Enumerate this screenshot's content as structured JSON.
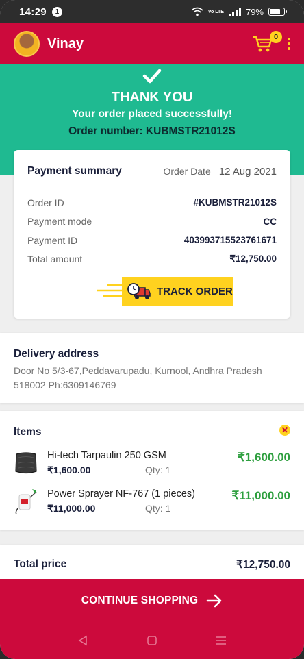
{
  "status_bar": {
    "time": "14:29",
    "notification_count": "1",
    "network": "Vo LTE",
    "battery": "79%",
    "battery_level": 0.79
  },
  "header": {
    "username": "Vinay",
    "cart_count": "0"
  },
  "confirmation": {
    "title": "THANK YOU",
    "message": "Your order placed successfully!",
    "order_number": "Order number: KUBMSTR21012S"
  },
  "payment_summary": {
    "title": "Payment summary",
    "order_date_label": "Order Date",
    "order_date": "12 Aug 2021",
    "rows": [
      {
        "label": "Order ID",
        "value": "#KUBMSTR21012S"
      },
      {
        "label": "Payment mode",
        "value": "CC"
      },
      {
        "label": "Payment ID",
        "value": "403993715523761671"
      },
      {
        "label": "Total amount",
        "value": "₹12,750.00"
      }
    ],
    "track_button": "TRACK ORDER"
  },
  "delivery": {
    "title": "Delivery address",
    "address": "Door No 5/3-67,Peddavarupadu, Kurnool, Andhra Pradesh 518002 Ph:6309146769"
  },
  "items": {
    "title": "Items",
    "list": [
      {
        "name": "Hi-tech Tarpaulin 250 GSM",
        "price": "₹1,600.00",
        "qty": "Qty: 1",
        "total": "₹1,600.00",
        "icon": "tarpaulin-icon"
      },
      {
        "name": "Power Sprayer NF-767 (1 pieces)",
        "price": "₹11,000.00",
        "qty": "Qty: 1",
        "total": "₹11,000.00",
        "icon": "sprayer-icon"
      }
    ]
  },
  "total": {
    "label": "Total price",
    "value": "₹12,750.00"
  },
  "continue_button": "CONTINUE SHOPPING",
  "colors": {
    "brand_red": "#cc0a3c",
    "success_green": "#1fba91",
    "accent_yellow": "#ffd21f",
    "price_green": "#2e9f3f"
  }
}
